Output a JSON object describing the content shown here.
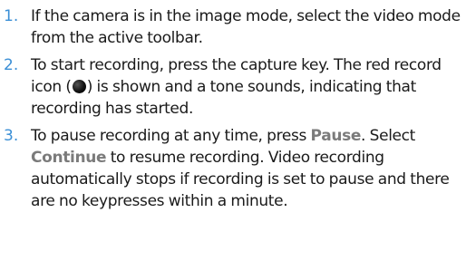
{
  "steps": [
    {
      "number": "1.",
      "text": "If the camera is in the image mode, select the video mode from the active toolbar."
    },
    {
      "number": "2.",
      "text_before_icon": "To start recording, press the capture key. The red record icon (",
      "record_icon": "record-icon",
      "text_after_icon": ") is shown and a tone sounds, indicating that recording has started."
    },
    {
      "number": "3.",
      "text_part1": "To pause recording at any time, press ",
      "pause_label": "Pause",
      "text_part2": ". Select ",
      "continue_label": "Continue",
      "text_part3": " to resume recording. Video recording automatically stops if recording is set to pause and there are no keypresses within a minute."
    }
  ],
  "colors": {
    "step_number": "#3b8fd6",
    "keyword": "#7b7b7b",
    "text": "#1a1a1a"
  }
}
